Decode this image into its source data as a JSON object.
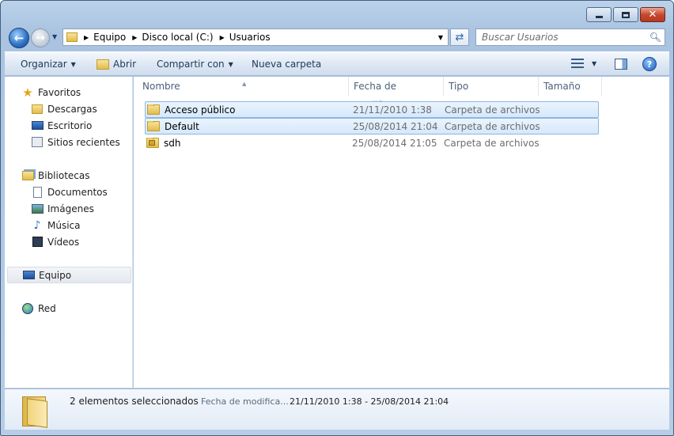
{
  "window": {
    "controls": {
      "minimize": "minimize",
      "maximize": "maximize",
      "close": "✕"
    }
  },
  "address": {
    "crumbs": [
      "Equipo",
      "Disco local (C:)",
      "Usuarios"
    ],
    "search_placeholder": "Buscar Usuarios"
  },
  "toolbar": {
    "organize_label": "Organizar",
    "open_label": "Abrir",
    "share_label": "Compartir con",
    "new_folder_label": "Nueva carpeta"
  },
  "nav": {
    "favorites": {
      "label": "Favoritos",
      "items": [
        {
          "label": "Descargas",
          "icon": "download-folder-icon"
        },
        {
          "label": "Escritorio",
          "icon": "desktop-icon"
        },
        {
          "label": "Sitios recientes",
          "icon": "recent-places-icon"
        }
      ]
    },
    "libraries": {
      "label": "Bibliotecas",
      "items": [
        {
          "label": "Documentos",
          "icon": "documents-icon"
        },
        {
          "label": "Imágenes",
          "icon": "pictures-icon"
        },
        {
          "label": "Música",
          "icon": "music-icon"
        },
        {
          "label": "Vídeos",
          "icon": "videos-icon"
        }
      ]
    },
    "computer": {
      "label": "Equipo"
    },
    "network": {
      "label": "Red"
    }
  },
  "columns": {
    "name": "Nombre",
    "date": "Fecha de modifica...",
    "type": "Tipo",
    "size": "Tamaño"
  },
  "files": [
    {
      "name": "Acceso público",
      "date": "21/11/2010 1:38",
      "type": "Carpeta de archivos",
      "selected": true
    },
    {
      "name": "Default",
      "date": "25/08/2014 21:04",
      "type": "Carpeta de archivos",
      "selected": true
    },
    {
      "name": "sdh",
      "date": "25/08/2014 21:05",
      "type": "Carpeta de archivos",
      "selected": false
    }
  ],
  "details": {
    "count": "2 elementos seleccionados",
    "date_label": "Fecha de modifica...",
    "date_value": "21/11/2010 1:38 - 25/08/2014 21:04"
  },
  "colors": {
    "selection_bg": "#d5e8fb",
    "selection_border": "#8fb6df",
    "frame": "#a9c3e1"
  }
}
